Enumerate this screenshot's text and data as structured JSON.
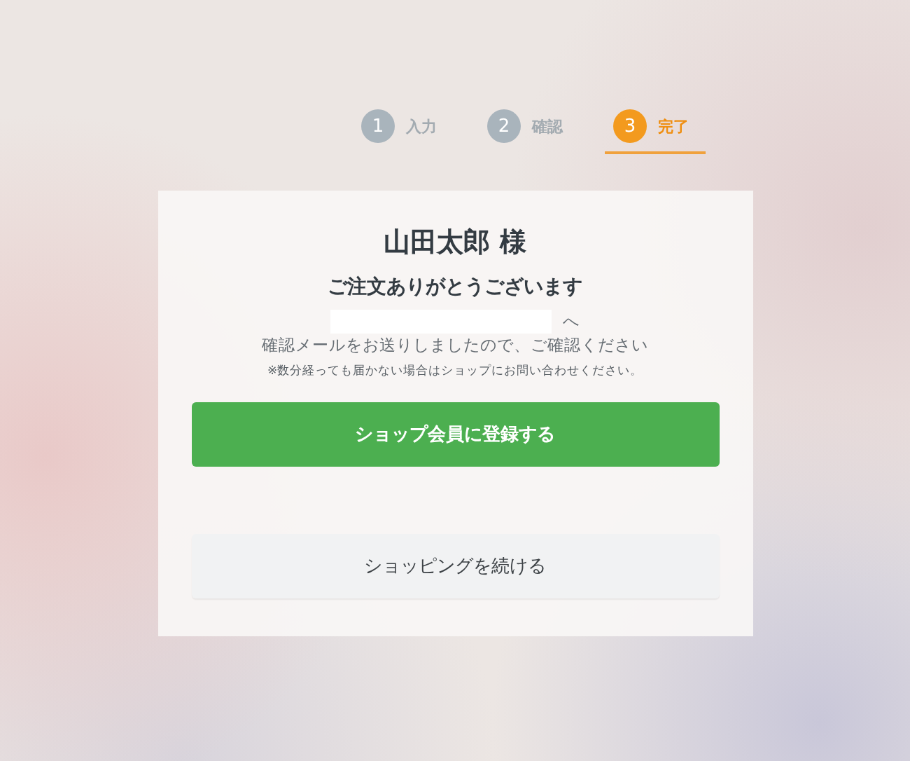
{
  "steps": [
    {
      "number": "1",
      "label": "入力",
      "selected": false
    },
    {
      "number": "2",
      "label": "確認",
      "selected": false
    },
    {
      "number": "3",
      "label": "完了",
      "selected": true
    }
  ],
  "card": {
    "name": "山田太郎 様",
    "thanks": "ご注文ありがとうございます",
    "email_suffix": "へ",
    "message": "確認メールをお送りしましたので、ご確認ください",
    "note": "※数分経っても届かない場合はショップにお問い合わせください。",
    "buttons": [
      {
        "label": "ショップ会員に登録する",
        "kind": "primary"
      },
      {
        "label": "ショッピングを続ける",
        "kind": "secondary"
      }
    ]
  }
}
